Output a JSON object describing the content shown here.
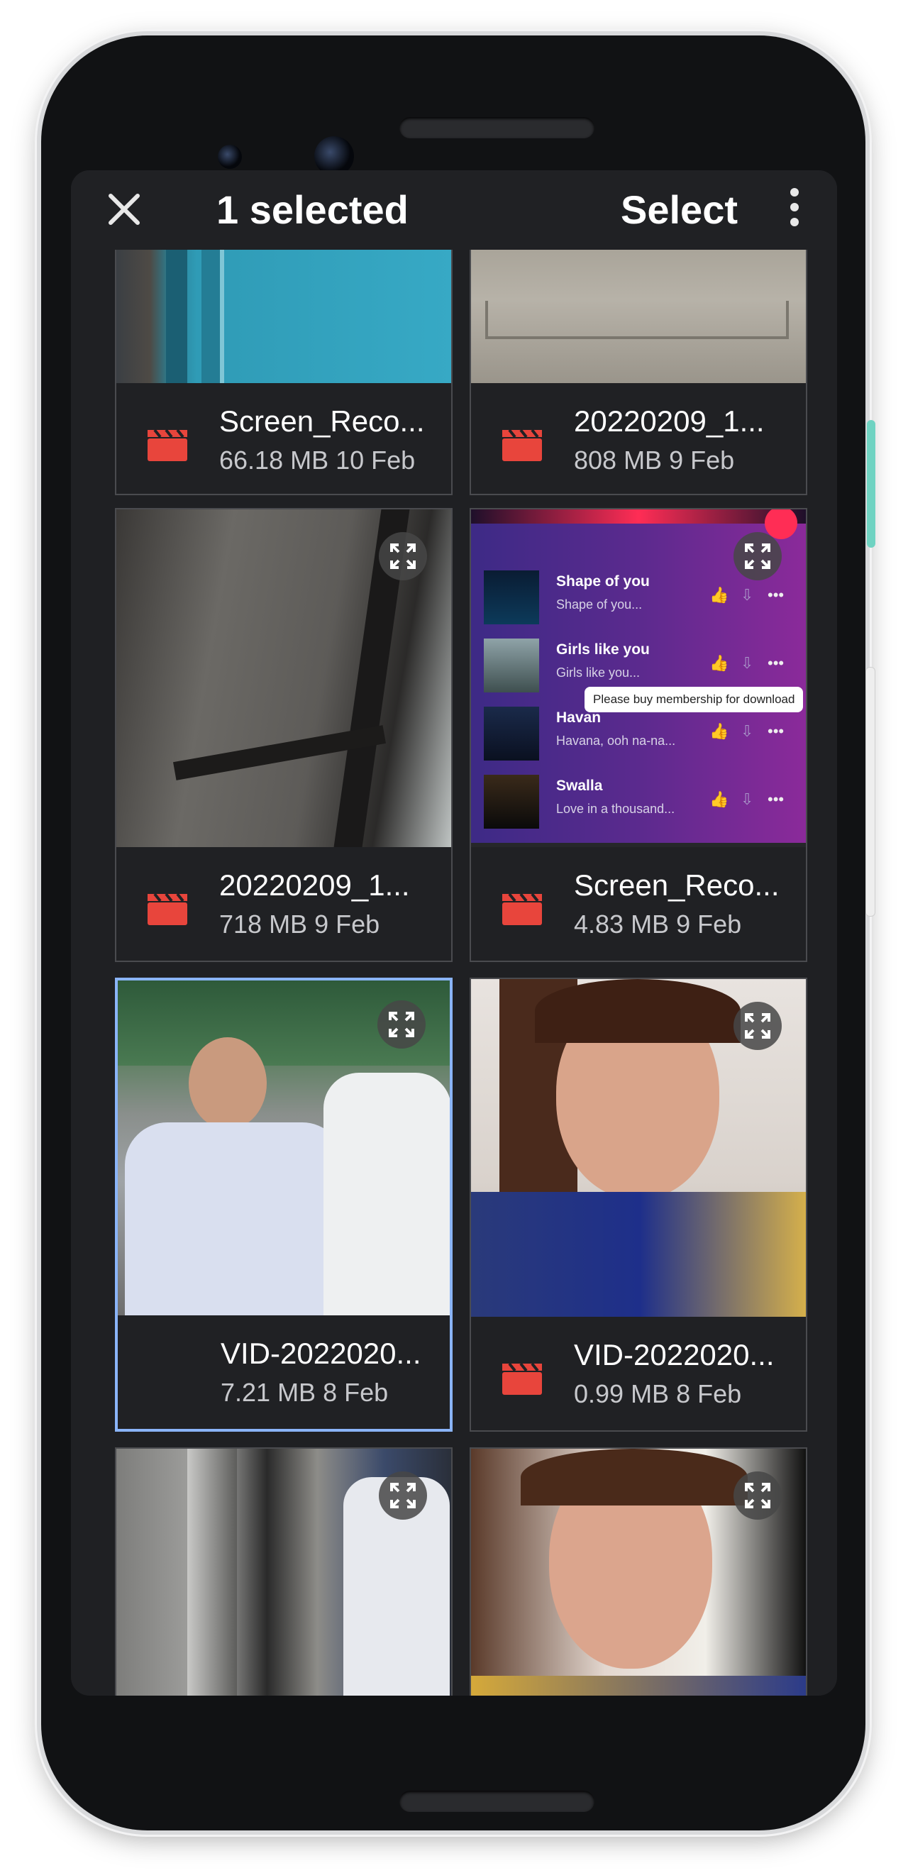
{
  "topbar": {
    "title": "1 selected",
    "select_label": "Select"
  },
  "icons": {
    "close": "close-icon",
    "more": "more-vert-icon",
    "video": "clapperboard-icon",
    "expand": "expand-icon",
    "check": "check-circle-icon"
  },
  "colors": {
    "accent": "#8ab4f8",
    "video_icon": "#e8453c",
    "background": "#1f2023"
  },
  "tiles": [
    {
      "name": "Screen_Reco...",
      "meta": "66.18 MB 10 Feb"
    },
    {
      "name": "20220209_1...",
      "meta": "808 MB 9 Feb"
    },
    {
      "name": "20220209_1...",
      "meta": "718 MB 9 Feb"
    },
    {
      "name": "Screen_Reco...",
      "meta": "4.83 MB 9 Feb"
    },
    {
      "name": "VID-2022020...",
      "meta": "7.21 MB 8 Feb",
      "selected": true
    },
    {
      "name": "VID-2022020...",
      "meta": "0.99 MB 8 Feb"
    },
    {
      "name": "",
      "meta": ""
    },
    {
      "name": "",
      "meta": ""
    }
  ],
  "music_preview": {
    "songs": [
      {
        "title": "Shape of you",
        "subtitle": "Shape of you..."
      },
      {
        "title": "Girls like you",
        "subtitle": "Girls like you..."
      },
      {
        "title": "Havan",
        "subtitle": "Havana, ooh na-na..."
      },
      {
        "title": "Swalla",
        "subtitle": "Love in a thousand..."
      }
    ],
    "tooltip": "Please buy membership for download"
  }
}
